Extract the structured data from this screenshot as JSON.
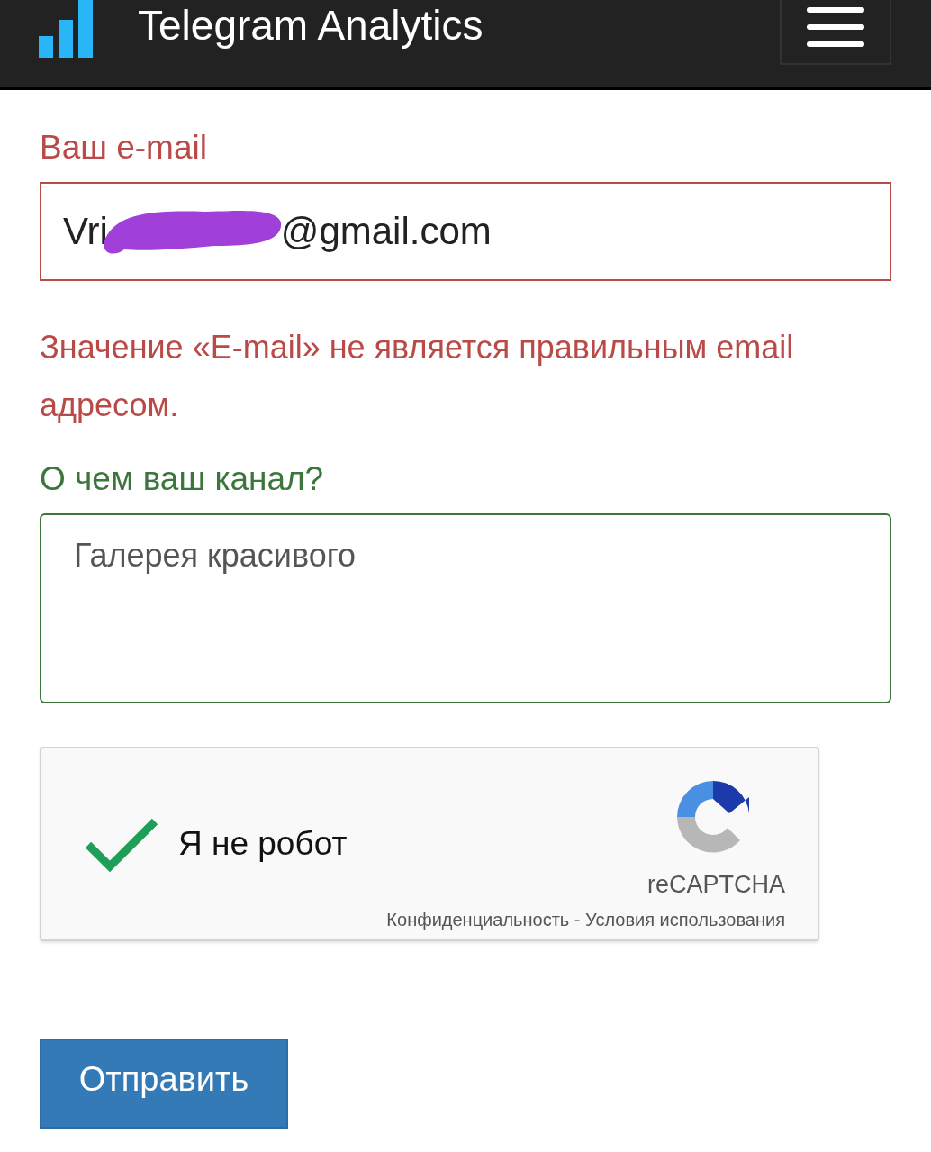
{
  "header": {
    "title": "Telegram Analytics"
  },
  "email": {
    "label": "Ваш e-mail",
    "invalid": true,
    "value_start": "Vri",
    "redacted": true,
    "value_end": "@gmail.com",
    "error": "Значение «E-mail» не является правильным email адресом."
  },
  "about": {
    "label": "О чем ваш канал?",
    "invalid": false,
    "value": "Галерея красивого"
  },
  "captcha": {
    "checked": true,
    "label": "Я не робот",
    "brand": "reCAPTCHA",
    "privacy": "Конфиденциальность",
    "separator": " - ",
    "terms": "Условия использования"
  },
  "submit": {
    "label": "Отправить"
  }
}
